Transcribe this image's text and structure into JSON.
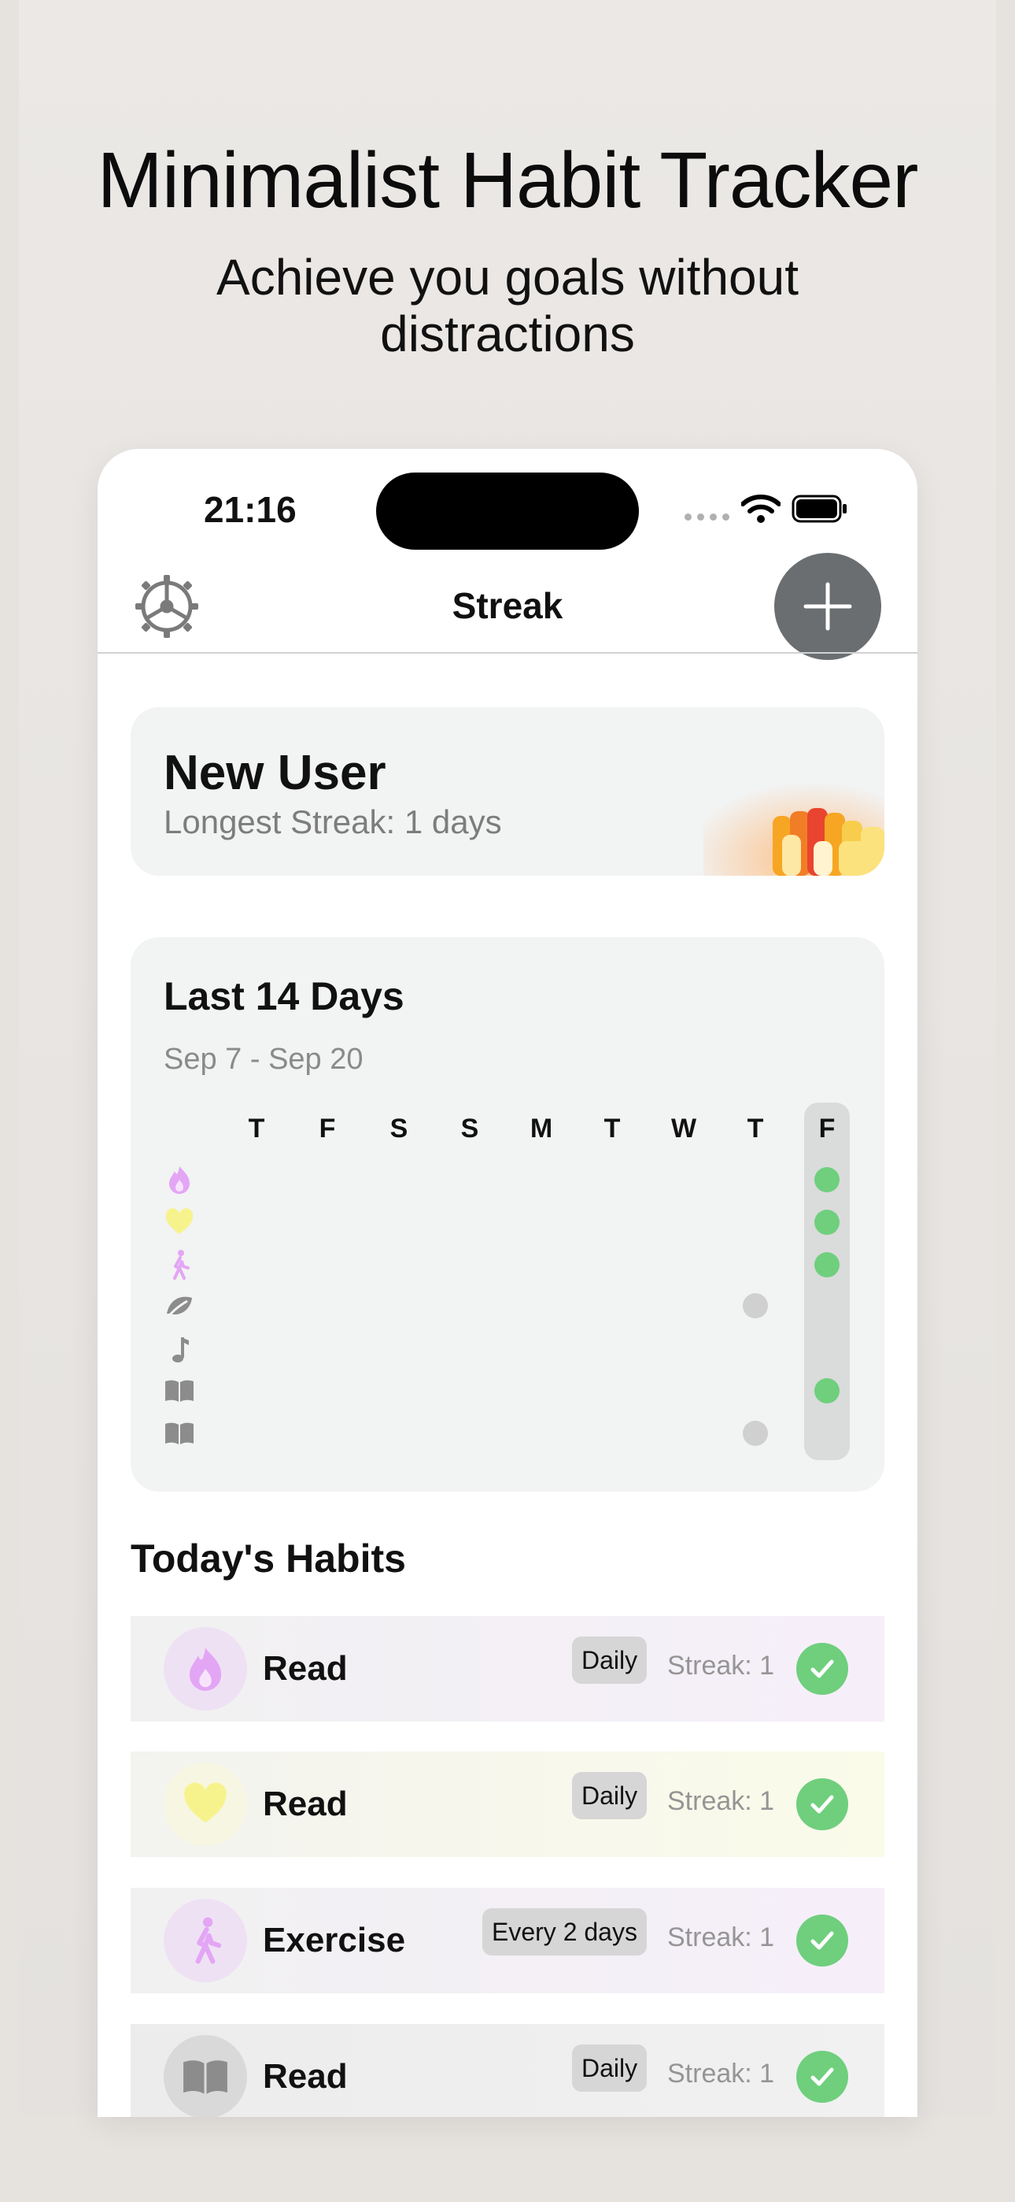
{
  "promo": {
    "title": "Minimalist Habit Tracker",
    "subtitle_line1": "Achieve you goals without",
    "subtitle_line2": "distractions"
  },
  "status_bar": {
    "time": "21:16"
  },
  "nav": {
    "title": "Streak",
    "settings_icon": "gear-icon",
    "add_icon": "plus-icon"
  },
  "user": {
    "name": "New User",
    "longest_streak": "Longest Streak: 1 days"
  },
  "last14": {
    "title": "Last 14 Days",
    "range": "Sep 7 - Sep 20",
    "day_headers": [
      "T",
      "F",
      "S",
      "S",
      "M",
      "T",
      "W",
      "T",
      "F"
    ],
    "rows": [
      {
        "icon": "flame-icon",
        "color": "#e3a6f5",
        "thursday": "",
        "friday": "done"
      },
      {
        "icon": "heart-icon",
        "color": "#f7f38c",
        "thursday": "",
        "friday": "done"
      },
      {
        "icon": "walking-icon",
        "color": "#e3a6f5",
        "thursday": "",
        "friday": "done"
      },
      {
        "icon": "leaf-icon",
        "color": "#8c8c8c",
        "thursday": "skip",
        "friday": ""
      },
      {
        "icon": "music-note-icon",
        "color": "#8c8c8c",
        "thursday": "",
        "friday": ""
      },
      {
        "icon": "book-icon",
        "color": "#8c8c8c",
        "thursday": "",
        "friday": "done"
      },
      {
        "icon": "book-icon",
        "color": "#8c8c8c",
        "thursday": "skip",
        "friday": ""
      }
    ]
  },
  "habits_section": {
    "title": "Today's Habits",
    "items": [
      {
        "name": "Read",
        "frequency": "Daily",
        "streak": "Streak: 1",
        "icon": "flame-icon",
        "color": "#e3a6f5"
      },
      {
        "name": "Read",
        "frequency": "Daily",
        "streak": "Streak: 1",
        "icon": "heart-icon",
        "color": "#f7f38c"
      },
      {
        "name": "Exercise",
        "frequency": "Every 2 days",
        "streak": "Streak: 1",
        "icon": "walking-icon",
        "color": "#e3a6f5"
      },
      {
        "name": "Read",
        "frequency": "Daily",
        "streak": "Streak: 1",
        "icon": "book-icon",
        "color": "#8c8c8c"
      }
    ]
  },
  "colors": {
    "done": "#6fcf7d",
    "skip": "#d0d0d0",
    "accent_button": "#6b6e70"
  }
}
